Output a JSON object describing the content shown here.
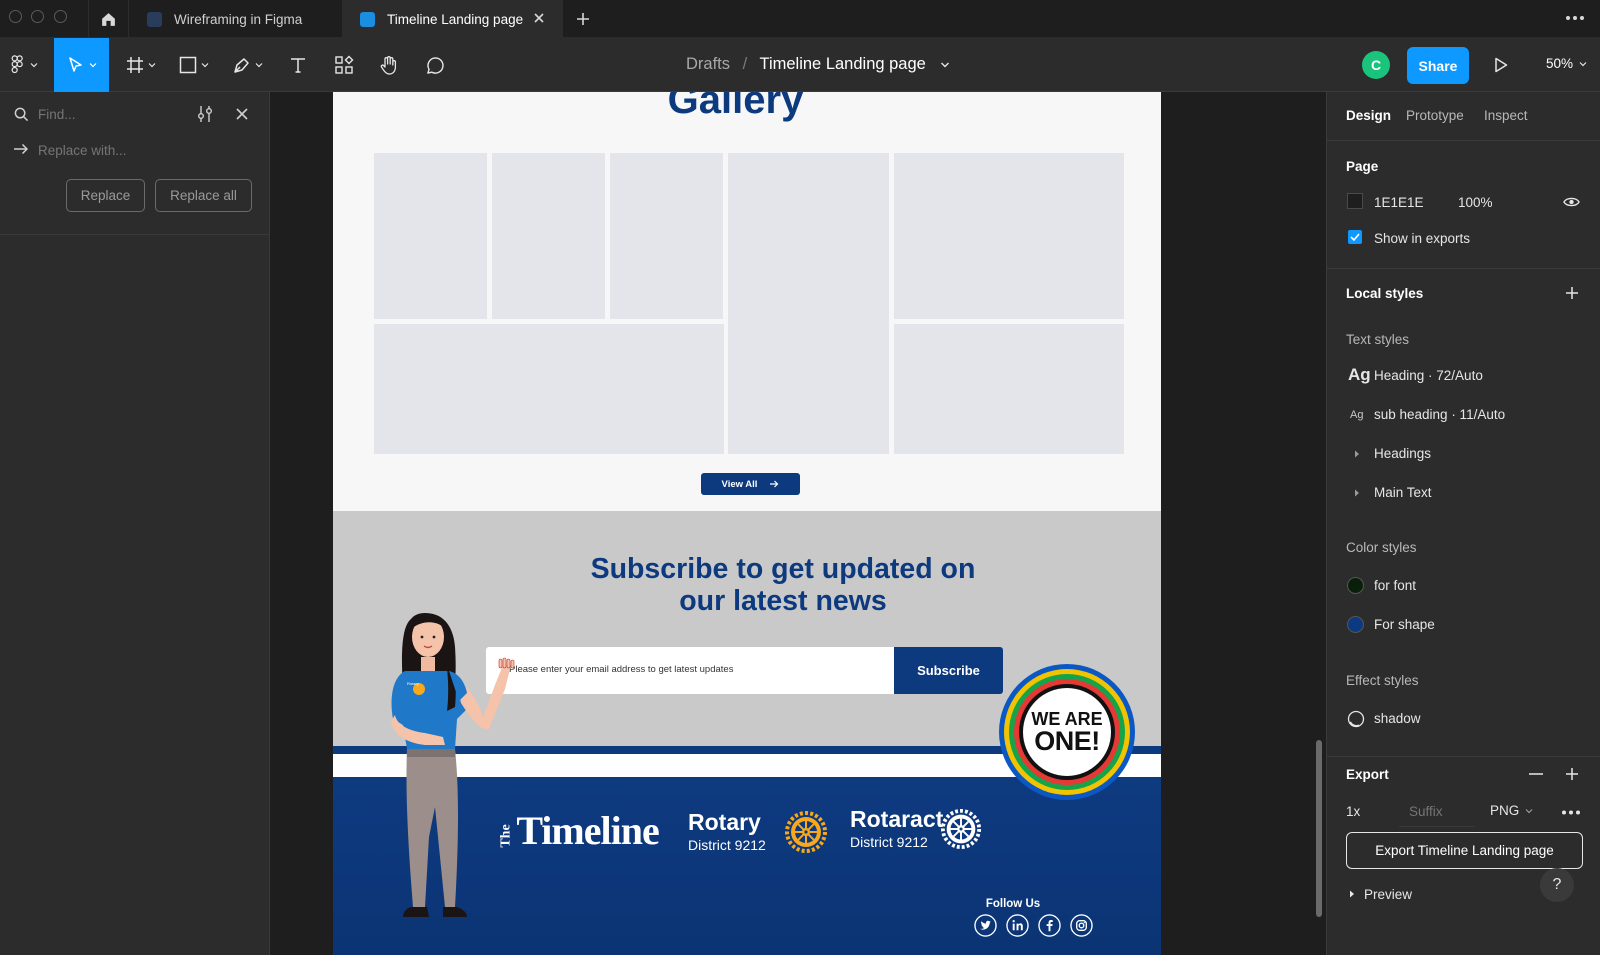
{
  "tabs": [
    {
      "label": "Wireframing in Figma",
      "active": false
    },
    {
      "label": "Timeline Landing page",
      "active": true
    }
  ],
  "toolbar": {
    "breadcrumb_root": "Drafts",
    "breadcrumb_sep": "/",
    "file_name": "Timeline Landing page",
    "avatar_initial": "C",
    "share_label": "Share",
    "zoom": "50%"
  },
  "find_panel": {
    "find_placeholder": "Find...",
    "replace_placeholder": "Replace with...",
    "replace_label": "Replace",
    "replace_all_label": "Replace all"
  },
  "frame": {
    "gallery_title": "Gallery",
    "view_all_label": "View All",
    "subscribe_title_line1": "Subscribe to get updated on",
    "subscribe_title_line2": "our latest news",
    "email_placeholder": "Please enter your email address to get latest updates",
    "subscribe_button": "Subscribe",
    "badge_line1": "WE ARE",
    "badge_line2": "ONE!",
    "logo_timeline_the": "The",
    "logo_timeline": "Timeline",
    "logo_rotary": "Rotary",
    "logo_rotary_district": "District 9212",
    "logo_rotaract": "Rotaract",
    "logo_rotaract_district": "District 9212",
    "follow_us": "Follow Us",
    "shirt_badge": "Rotary"
  },
  "design_panel": {
    "tabs": [
      "Design",
      "Prototype",
      "Inspect"
    ],
    "page_heading": "Page",
    "page_color_hex": "1E1E1E",
    "page_opacity": "100%",
    "show_in_exports": "Show in exports",
    "local_styles": "Local styles",
    "text_styles_heading": "Text styles",
    "text_styles": [
      {
        "glyph": "Ag",
        "label": "Heading · 72/Auto"
      },
      {
        "glyph": "Ag",
        "label": "sub heading · 11/Auto"
      }
    ],
    "text_groups": [
      "Headings",
      "Main Text"
    ],
    "color_styles_heading": "Color styles",
    "color_styles": [
      {
        "label": "for font",
        "color": "#0a1f0a"
      },
      {
        "label": "For shape",
        "color": "#0b3a82"
      }
    ],
    "effect_styles_heading": "Effect styles",
    "effect_styles": [
      {
        "label": "shadow"
      }
    ],
    "export_heading": "Export",
    "export_scale": "1x",
    "export_suffix_placeholder": "Suffix",
    "export_format": "PNG",
    "export_button": "Export Timeline Landing page",
    "preview_label": "Preview",
    "help_label": "?"
  },
  "colors": {
    "brand_blue": "#0d3a7e",
    "figma_blue": "#0d99ff",
    "avatar_green": "#1bc47d"
  }
}
